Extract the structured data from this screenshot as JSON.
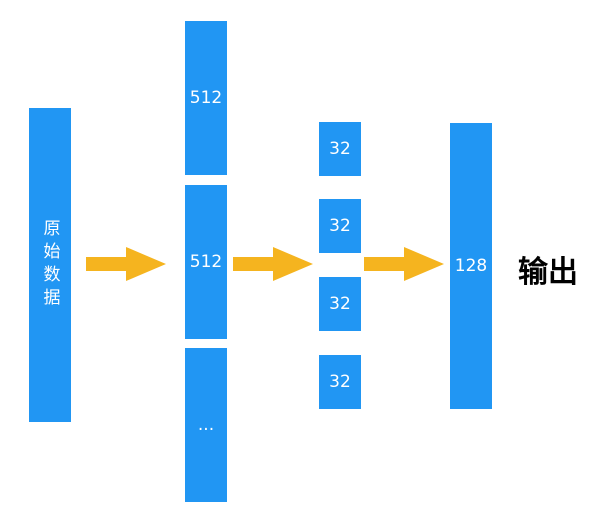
{
  "input": {
    "label": "原始数据"
  },
  "layer1": {
    "boxes": [
      "512",
      "512",
      "..."
    ]
  },
  "layer2": {
    "boxes": [
      "32",
      "32",
      "32",
      "32"
    ]
  },
  "layer3": {
    "boxes": [
      "128"
    ]
  },
  "output": {
    "label": "输出"
  },
  "colors": {
    "box": "#2196f3",
    "arrow": "#f5b41f",
    "text_on_box": "#ffffff"
  }
}
